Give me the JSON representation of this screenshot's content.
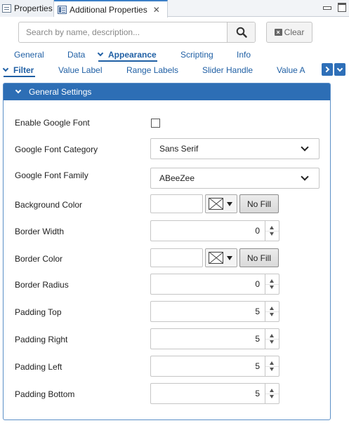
{
  "window_tabs": [
    {
      "label": "Properties"
    },
    {
      "label": "Additional Properties"
    }
  ],
  "search": {
    "placeholder": "Search by name, description...",
    "value": ""
  },
  "clear_label": "Clear",
  "category_tabs": [
    {
      "label": "General"
    },
    {
      "label": "Data"
    },
    {
      "label": "Appearance",
      "selected": true
    },
    {
      "label": "Scripting"
    },
    {
      "label": "Info"
    }
  ],
  "sub_tabs": [
    {
      "label": "Filter",
      "selected": true
    },
    {
      "label": "Value Label"
    },
    {
      "label": "Range Labels"
    },
    {
      "label": "Slider Handle"
    },
    {
      "label": "Value A"
    }
  ],
  "section": {
    "title": "General Settings"
  },
  "fields": {
    "enable_google_font": {
      "label": "Enable Google Font",
      "checked": false
    },
    "font_category": {
      "label": "Google Font Category",
      "value": "Sans Serif"
    },
    "font_family": {
      "label": "Google Font Family",
      "value": "ABeeZee"
    },
    "background_color": {
      "label": "Background Color",
      "value": "",
      "no_fill_label": "No Fill"
    },
    "border_width": {
      "label": "Border Width",
      "value": "0"
    },
    "border_color": {
      "label": "Border Color",
      "value": "",
      "no_fill_label": "No Fill"
    },
    "border_radius": {
      "label": "Border Radius",
      "value": "0"
    },
    "padding_top": {
      "label": "Padding Top",
      "value": "5"
    },
    "padding_right": {
      "label": "Padding Right",
      "value": "5"
    },
    "padding_left": {
      "label": "Padding Left",
      "value": "5"
    },
    "padding_bottom": {
      "label": "Padding Bottom",
      "value": "5"
    }
  },
  "colors": {
    "accent": "#2d6eb5",
    "link": "#1f5fa4"
  },
  "icons": [
    "properties-icon",
    "additional-properties-icon",
    "close-icon",
    "minimize-icon",
    "maximize-icon",
    "search-icon",
    "clear-icon",
    "chevron-down-icon",
    "chevron-right-icon",
    "color-swatch-icon",
    "spinner-up-icon",
    "spinner-down-icon"
  ]
}
